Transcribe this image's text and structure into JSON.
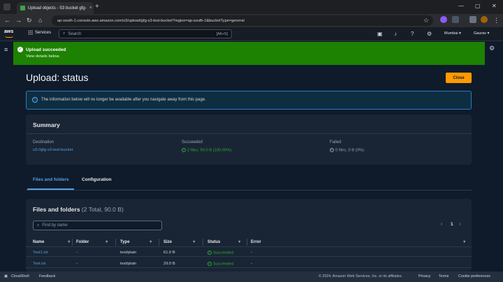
{
  "browser": {
    "tab_title": "Upload objects - S3 bucket gfg-",
    "tab_close": "×",
    "new_tab": "+",
    "url": "ap-south-1.console.aws.amazon.com/s3/upload/gfg-s3-test-bucket?region=ap-south-1&bucketType=general"
  },
  "aws_nav": {
    "logo": "aws",
    "services_label": "Services",
    "search_placeholder": "Search",
    "search_shortcut": "[Alt+S]",
    "region": "Mumbai ▾",
    "account": "Gaurav ▾"
  },
  "banner": {
    "title": "Upload succeeded",
    "subtitle": "View details below.",
    "color": "#1d8102"
  },
  "page": {
    "title": "Upload: status",
    "close_label": "Close",
    "accent": "#ff9900"
  },
  "info_alert": {
    "text": "The information below will no longer be available after you navigate away from this page."
  },
  "summary": {
    "title": "Summary",
    "destination_label": "Destination",
    "destination_value": "s3://gfg-s3-test-bucket",
    "succeeded_label": "Succeeded",
    "succeeded_value": "2 files, 90.0 B (100.00%)",
    "failed_label": "Failed",
    "failed_value": "0 files, 0 B (0%)"
  },
  "tabs": [
    {
      "label": "Files and folders",
      "active": true
    },
    {
      "label": "Configuration",
      "active": false
    }
  ],
  "files": {
    "title": "Files and folders",
    "count": "(2 Total, 90.0 B)",
    "find_placeholder": "Find by name",
    "page_number": "1",
    "columns": [
      "Name",
      "Folder",
      "Type",
      "Size",
      "Status",
      "Error"
    ],
    "rows": [
      {
        "name": "Test1.txt",
        "folder": "-",
        "type": "text/plain",
        "size": "61.0 B",
        "status": "Succeeded",
        "error": "-"
      },
      {
        "name": "Test.txt",
        "folder": "-",
        "type": "text/plain",
        "size": "29.0 B",
        "status": "Succeeded",
        "error": "-"
      }
    ]
  },
  "footer": {
    "cloudshell": "CloudShell",
    "feedback": "Feedback",
    "copyright": "© 2024, Amazon Web Services, Inc. or its affiliates.",
    "privacy": "Privacy",
    "terms": "Terms",
    "cookies": "Cookie preferences"
  }
}
